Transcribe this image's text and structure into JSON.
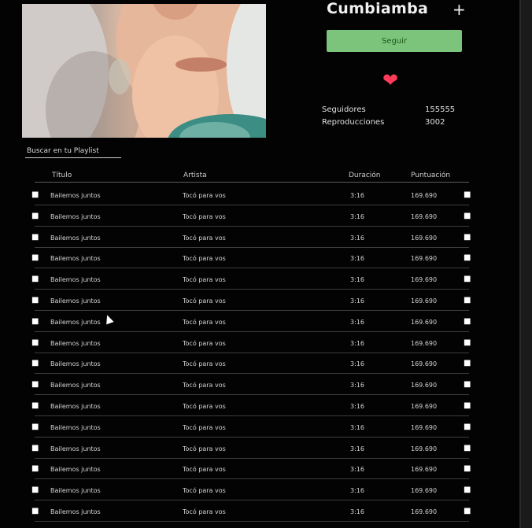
{
  "artist": {
    "name": "Cumbiamba",
    "add_label": "+",
    "follow_label": "Seguir",
    "heart_icon": "heart-icon",
    "heart_color": "#ff3b5a",
    "accent_color": "#7cc47c"
  },
  "stats": [
    {
      "label": "Seguidores",
      "value": "155555"
    },
    {
      "label": "Reproducciones",
      "value": "3002"
    }
  ],
  "search": {
    "placeholder": "Buscar en tu Playlist"
  },
  "table": {
    "columns": [
      "Título",
      "Artista",
      "Duración",
      "Puntuación"
    ],
    "rows": [
      {
        "title": "Bailemos juntos",
        "artist": "Tocó para vos",
        "duration": "3:16",
        "score": "169.690"
      },
      {
        "title": "Bailemos juntos",
        "artist": "Tocó para vos",
        "duration": "3:16",
        "score": "169.690"
      },
      {
        "title": "Bailemos juntos",
        "artist": "Tocó para vos",
        "duration": "3:16",
        "score": "169.690"
      },
      {
        "title": "Bailemos juntos",
        "artist": "Tocó para vos",
        "duration": "3:16",
        "score": "169.690"
      },
      {
        "title": "Bailemos juntos",
        "artist": "Tocó para vos",
        "duration": "3:16",
        "score": "169.690"
      },
      {
        "title": "Bailemos juntos",
        "artist": "Tocó para vos",
        "duration": "3:16",
        "score": "169.690"
      },
      {
        "title": "Bailemos juntos",
        "artist": "Tocó para vos",
        "duration": "3:16",
        "score": "169.690"
      },
      {
        "title": "Bailemos juntos",
        "artist": "Tocó para vos",
        "duration": "3:16",
        "score": "169.690"
      },
      {
        "title": "Bailemos juntos",
        "artist": "Tocó para vos",
        "duration": "3:16",
        "score": "169.690"
      },
      {
        "title": "Bailemos juntos",
        "artist": "Tocó para vos",
        "duration": "3:16",
        "score": "169.690"
      },
      {
        "title": "Bailemos juntos",
        "artist": "Tocó para vos",
        "duration": "3:16",
        "score": "169.690"
      },
      {
        "title": "Bailemos juntos",
        "artist": "Tocó para vos",
        "duration": "3:16",
        "score": "169.690"
      },
      {
        "title": "Bailemos juntos",
        "artist": "Tocó para vos",
        "duration": "3:16",
        "score": "169.690"
      },
      {
        "title": "Bailemos juntos",
        "artist": "Tocó para vos",
        "duration": "3:16",
        "score": "169.690"
      },
      {
        "title": "Bailemos juntos",
        "artist": "Tocó para vos",
        "duration": "3:16",
        "score": "169.690"
      },
      {
        "title": "Bailemos juntos",
        "artist": "Tocó para vos",
        "duration": "3:16",
        "score": "169.690"
      }
    ]
  }
}
